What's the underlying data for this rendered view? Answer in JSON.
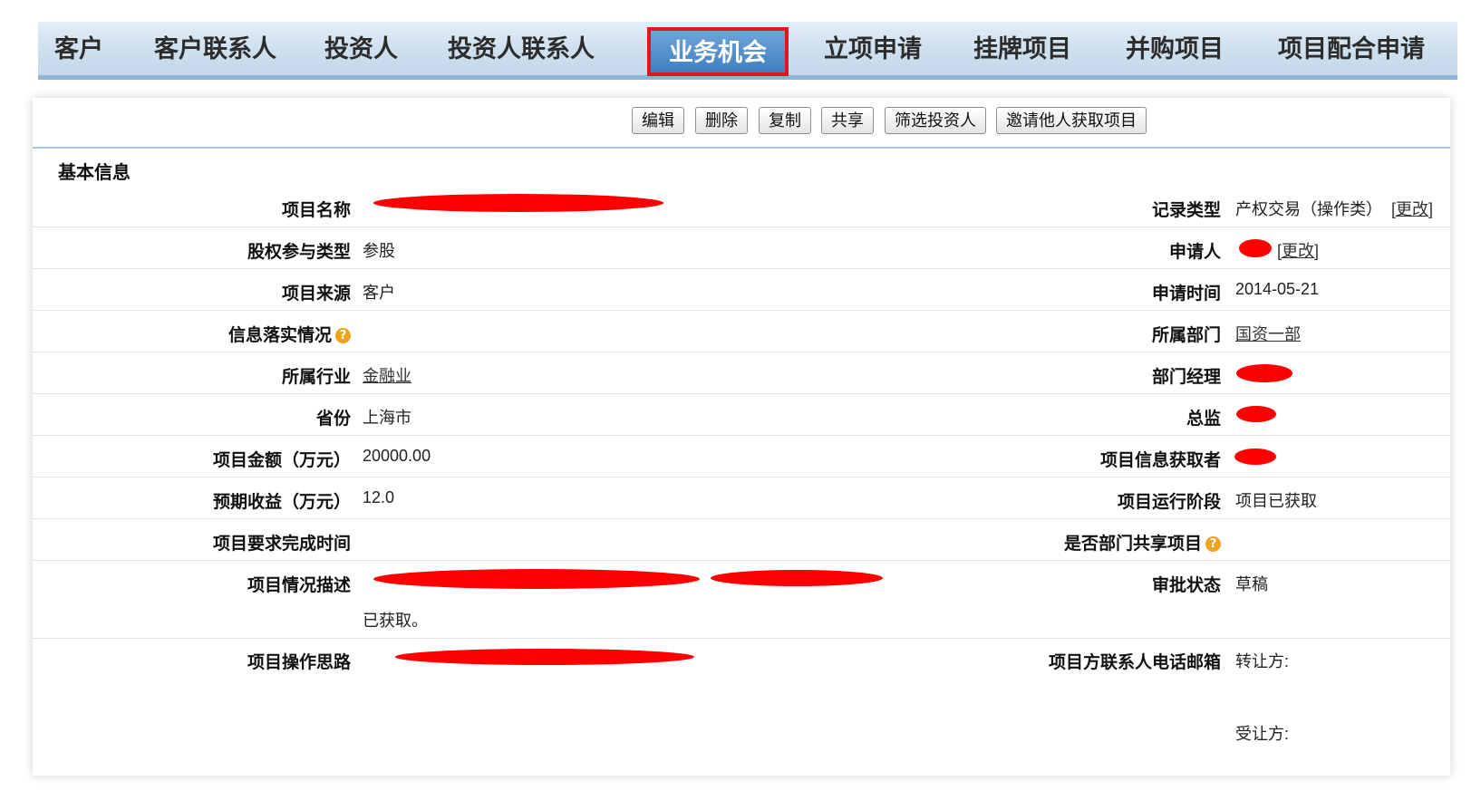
{
  "nav": {
    "tabs": [
      {
        "label": "客户"
      },
      {
        "label": "客户联系人"
      },
      {
        "label": "投资人"
      },
      {
        "label": "投资人联系人"
      },
      {
        "label": "业务机会"
      },
      {
        "label": "立项申请"
      },
      {
        "label": "挂牌项目"
      },
      {
        "label": "并购项目"
      },
      {
        "label": "项目配合申请"
      }
    ]
  },
  "toolbar": {
    "edit": "编辑",
    "delete": "删除",
    "copy": "复制",
    "share": "共享",
    "filter_investors": "筛选投资人",
    "invite": "邀请他人获取项目"
  },
  "section": {
    "title": "基本信息"
  },
  "fields": {
    "project_name": {
      "label": "项目名称"
    },
    "record_type": {
      "label": "记录类型",
      "value": "产权交易（操作类）",
      "action": "[更改]"
    },
    "equity_type": {
      "label": "股权参与类型",
      "value": "参股"
    },
    "applicant": {
      "label": "申请人",
      "action": "[更改]"
    },
    "project_source": {
      "label": "项目来源",
      "value": "客户"
    },
    "apply_time": {
      "label": "申请时间",
      "value": "2014-05-21"
    },
    "info_status": {
      "label": "信息落实情况"
    },
    "department": {
      "label": "所属部门",
      "value": "国资一部"
    },
    "industry": {
      "label": "所属行业",
      "value": "金融业"
    },
    "dept_manager": {
      "label": "部门经理"
    },
    "province": {
      "label": "省份",
      "value": "上海市"
    },
    "director": {
      "label": "总监"
    },
    "amount": {
      "label": "项目金额（万元）",
      "value": "20000.00"
    },
    "info_acquirer": {
      "label": "项目信息获取者"
    },
    "expected_income": {
      "label": "预期收益（万元）",
      "value": "12.0"
    },
    "stage": {
      "label": "项目运行阶段",
      "value": "项目已获取"
    },
    "deadline": {
      "label": "项目要求完成时间"
    },
    "dept_shared": {
      "label": "是否部门共享项目"
    },
    "description": {
      "label": "项目情况描述",
      "value_tail": "已获取。"
    },
    "approval": {
      "label": "审批状态",
      "value": "草稿"
    },
    "approach": {
      "label": "项目操作思路"
    },
    "contact": {
      "label": "项目方联系人电话邮箱",
      "transferor": "转让方:",
      "transferee": "受让方:"
    }
  },
  "icons": {
    "help": "?"
  },
  "colors": {
    "highlight": "#e3141b",
    "redaction": "#ff0000",
    "active_tab": "#3f7fc0"
  }
}
